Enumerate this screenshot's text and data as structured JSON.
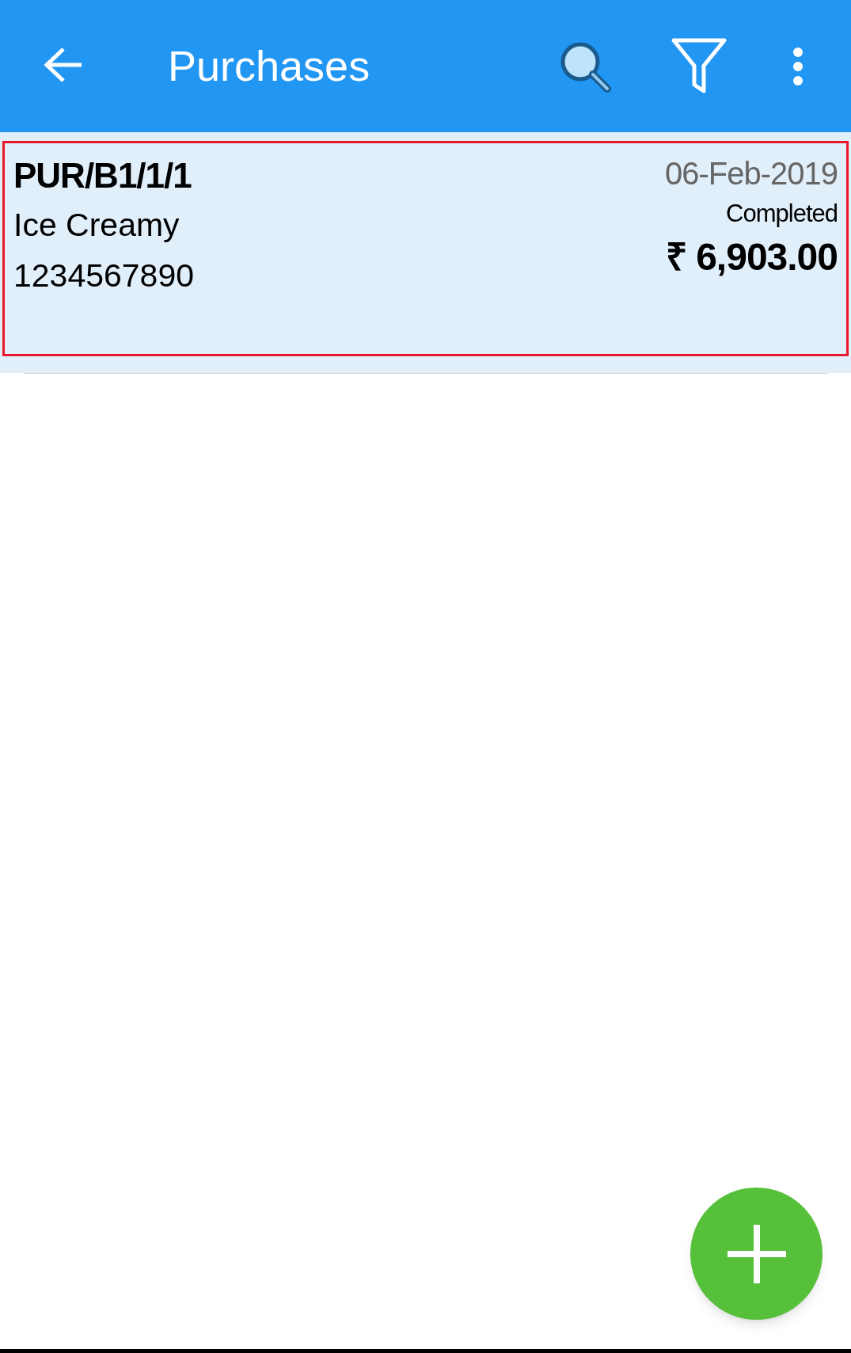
{
  "app_bar": {
    "title": "Purchases"
  },
  "purchases": [
    {
      "number": "PUR/B1/1/1",
      "party": "Ice Creamy",
      "phone": "1234567890",
      "date": "06-Feb-2019",
      "status": "Completed",
      "amount": "₹ 6,903.00",
      "selected": true
    }
  ]
}
